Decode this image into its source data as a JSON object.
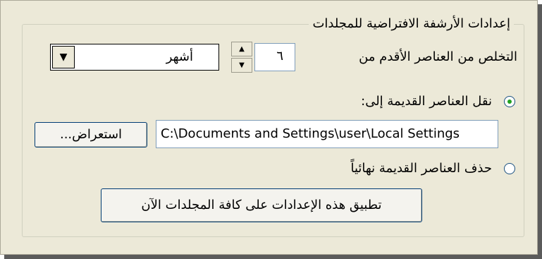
{
  "group": {
    "legend": "إعدادات الأرشفة الافتراضية للمجلدات"
  },
  "cleanup": {
    "label": "التخلص من العناصر الأقدم من",
    "value": "٦",
    "unit": "أشهر"
  },
  "move_option": {
    "label": "نقل العناصر القديمة إلى:",
    "selected": true
  },
  "archive_path": {
    "value": "C:\\Documents and Settings\\user\\Local Settings"
  },
  "browse_button": {
    "label": "استعراض..."
  },
  "delete_option": {
    "label": "حذف العناصر القديمة نهائياً",
    "selected": false
  },
  "apply_button": {
    "label": "تطبيق هذه الإعدادات على كافة المجلدات الآن"
  },
  "icons": {
    "spin_up": "up-arrow-icon",
    "spin_down": "down-arrow-icon",
    "combo_dropdown": "dropdown-arrow-icon"
  }
}
